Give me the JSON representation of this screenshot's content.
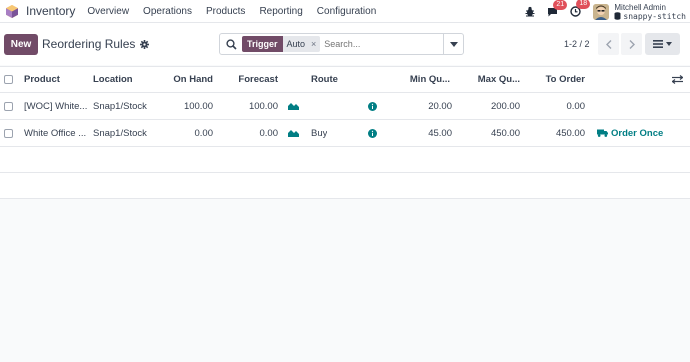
{
  "topbar": {
    "app_name": "Inventory",
    "nav": [
      "Overview",
      "Operations",
      "Products",
      "Reporting",
      "Configuration"
    ],
    "chat_count": "21",
    "activity_count": "18",
    "user_name": "Mitchell Admin",
    "db_name": "snappy-stitch"
  },
  "control": {
    "new_label": "New",
    "title": "Reordering Rules",
    "search": {
      "facet_label": "Trigger",
      "facet_value": "Auto",
      "facet_remove": "×",
      "placeholder": "Search..."
    },
    "pager": "1-2 / 2"
  },
  "table": {
    "columns": [
      "Product",
      "Location",
      "On Hand",
      "Forecast",
      "Route",
      "Min Qu...",
      "Max Qu...",
      "To Order"
    ],
    "rows": [
      {
        "product": "[WOC] White...",
        "location": "Snap1/Stock",
        "on_hand": "100.00",
        "forecast": "100.00",
        "route": "",
        "min_qty": "20.00",
        "max_qty": "200.00",
        "to_order": "0.00",
        "action": ""
      },
      {
        "product": "White Office ...",
        "location": "Snap1/Stock",
        "on_hand": "0.00",
        "forecast": "0.00",
        "route": "Buy",
        "min_qty": "45.00",
        "max_qty": "450.00",
        "to_order": "450.00",
        "action": "Order Once"
      }
    ]
  },
  "colors": {
    "brand": "#714b67",
    "accent_teal": "#017e84",
    "badge_red": "#e0505a"
  }
}
